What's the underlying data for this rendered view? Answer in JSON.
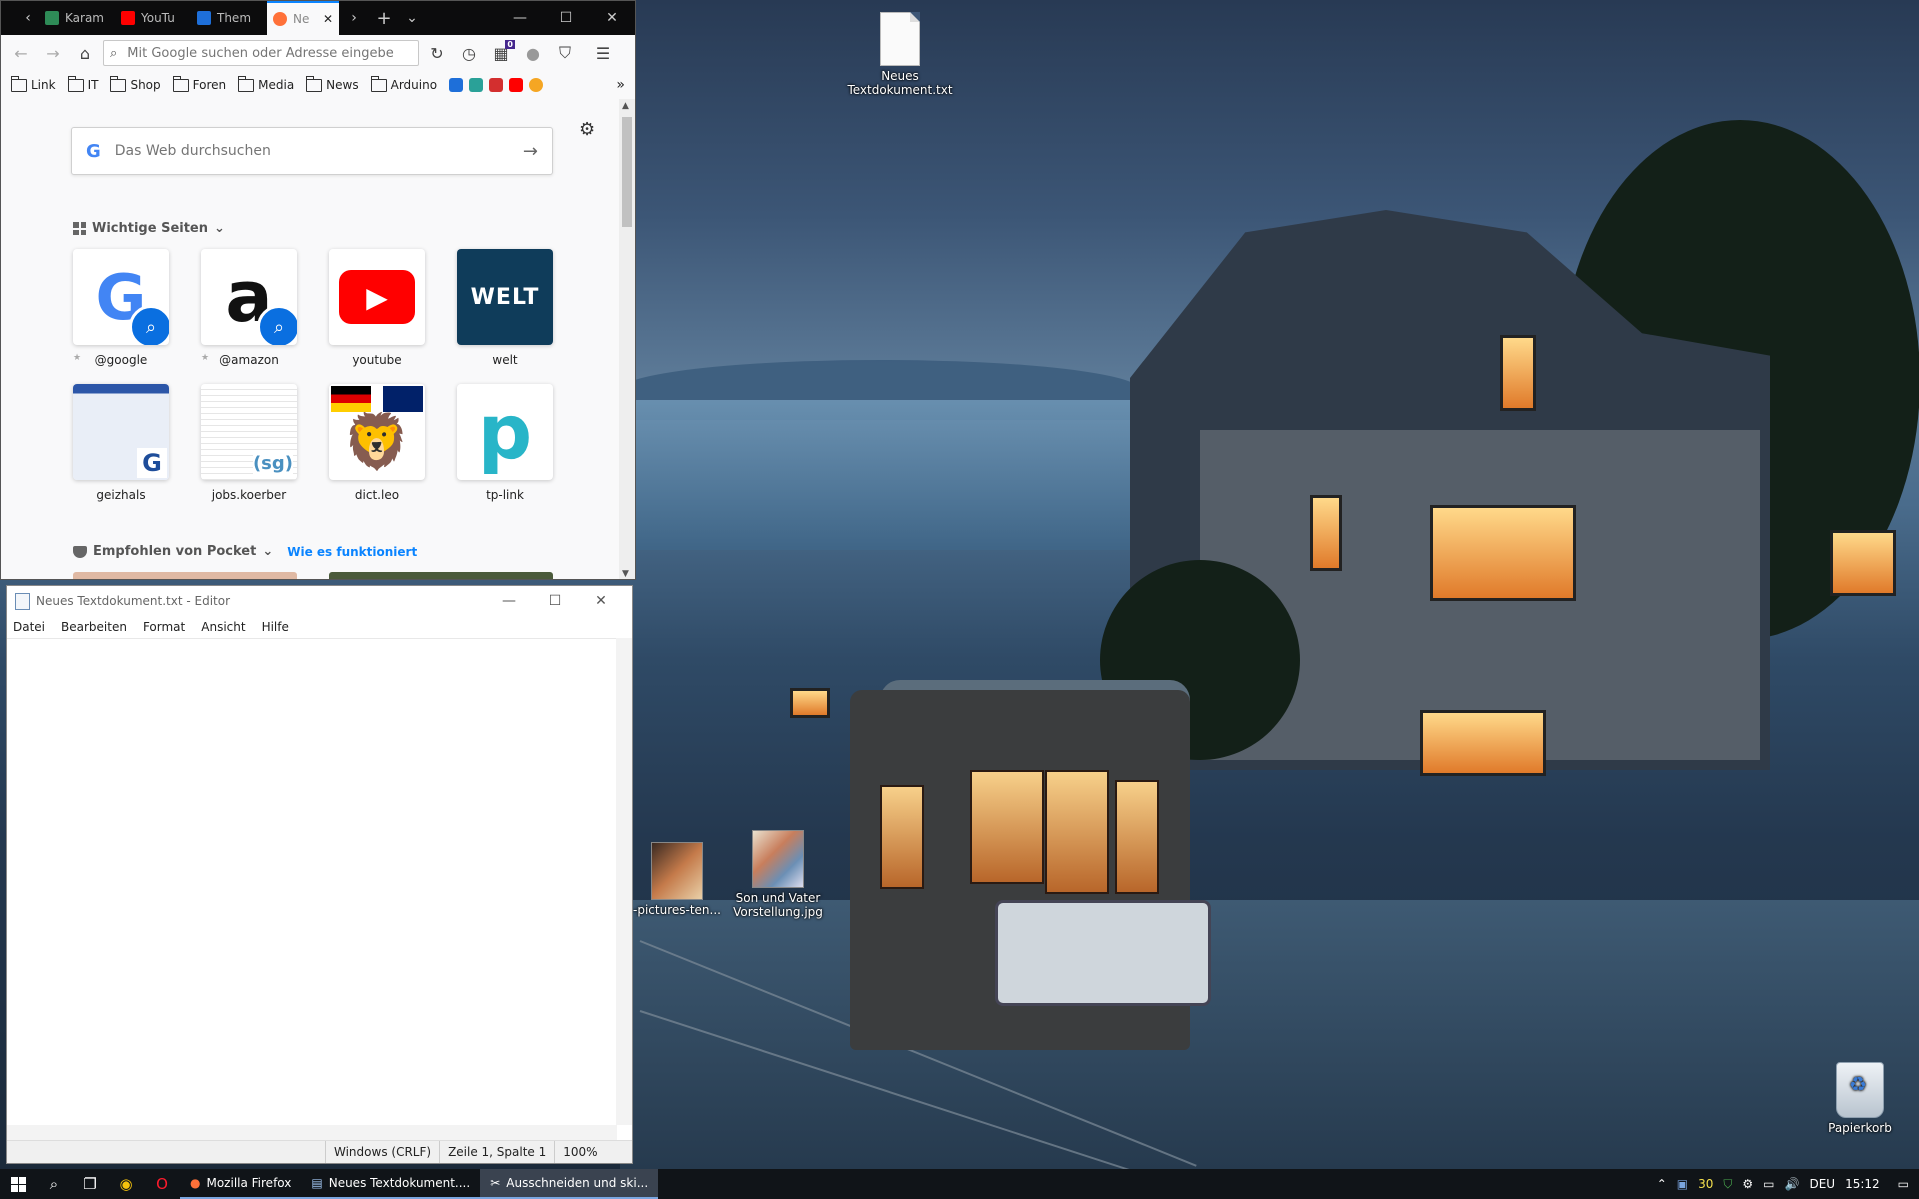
{
  "desktop": {
    "icons": [
      {
        "label": "Neues Textdokument.txt",
        "kind": "text-file"
      },
      {
        "label": "-pictures-ten...",
        "kind": "image"
      },
      {
        "label": "Son und Vater Vorstellung.jpg",
        "kind": "image"
      },
      {
        "label": "Papierkorb",
        "kind": "recycle-bin"
      }
    ]
  },
  "firefox": {
    "tabs": [
      {
        "label": "Karam",
        "color": "#2e8b57"
      },
      {
        "label": "YouTu",
        "color": "#ff0000"
      },
      {
        "label": "Them",
        "color": "#1e6fd9"
      },
      {
        "label": "Ne",
        "color": "#ff7139",
        "active": true
      }
    ],
    "urlbar_placeholder": "Mit Google suchen oder Adresse eingebe",
    "badge_count": "0",
    "bookmarks": [
      "Link",
      "IT",
      "Shop",
      "Foren",
      "Media",
      "News",
      "Arduino"
    ],
    "bookmark_icons": [
      "#1e6fd9",
      "#2aa198",
      "#d32f2f",
      "#ff0000",
      "#f5a623"
    ],
    "search_placeholder": "Das Web durchsuchen",
    "search_letter": "G",
    "top_sites_title": "Wichtige Seiten",
    "top_sites": [
      {
        "label": "@google",
        "tile_text": "G",
        "color": "#4285f4",
        "search": true
      },
      {
        "label": "@amazon",
        "tile_text": "a",
        "color": "#111111",
        "search": true
      },
      {
        "label": "youtube",
        "tile_text": "▶",
        "color": "#ff0000"
      },
      {
        "label": "welt",
        "tile_text": "WELT",
        "color": "#0f3c5a"
      },
      {
        "label": "geizhals",
        "tile_text": "G",
        "color": "#1e4d9a"
      },
      {
        "label": "jobs.koerber",
        "tile_text": "(sg)",
        "color": "#4a90c0"
      },
      {
        "label": "dict.leo",
        "tile_text": "🦁",
        "color": "#f2c200"
      },
      {
        "label": "tp-link",
        "tile_text": "p",
        "color": "#28b5c8"
      }
    ],
    "pocket_title": "Empfohlen von Pocket",
    "pocket_link": "Wie es funktioniert"
  },
  "notepad": {
    "title": "Neues Textdokument.txt - Editor",
    "menu": [
      "Datei",
      "Bearbeiten",
      "Format",
      "Ansicht",
      "Hilfe"
    ],
    "content": "",
    "status": {
      "encoding": "Windows (CRLF)",
      "position": "Zeile 1, Spalte 1",
      "zoom": "100%"
    }
  },
  "taskbar": {
    "tasks": [
      {
        "label": "Mozilla Firefox"
      },
      {
        "label": "Neues Textdokument...."
      },
      {
        "label": "Ausschneiden und ski...",
        "active": true
      }
    ],
    "tray": {
      "number": "30",
      "language": "DEU",
      "time": "15:12"
    }
  }
}
